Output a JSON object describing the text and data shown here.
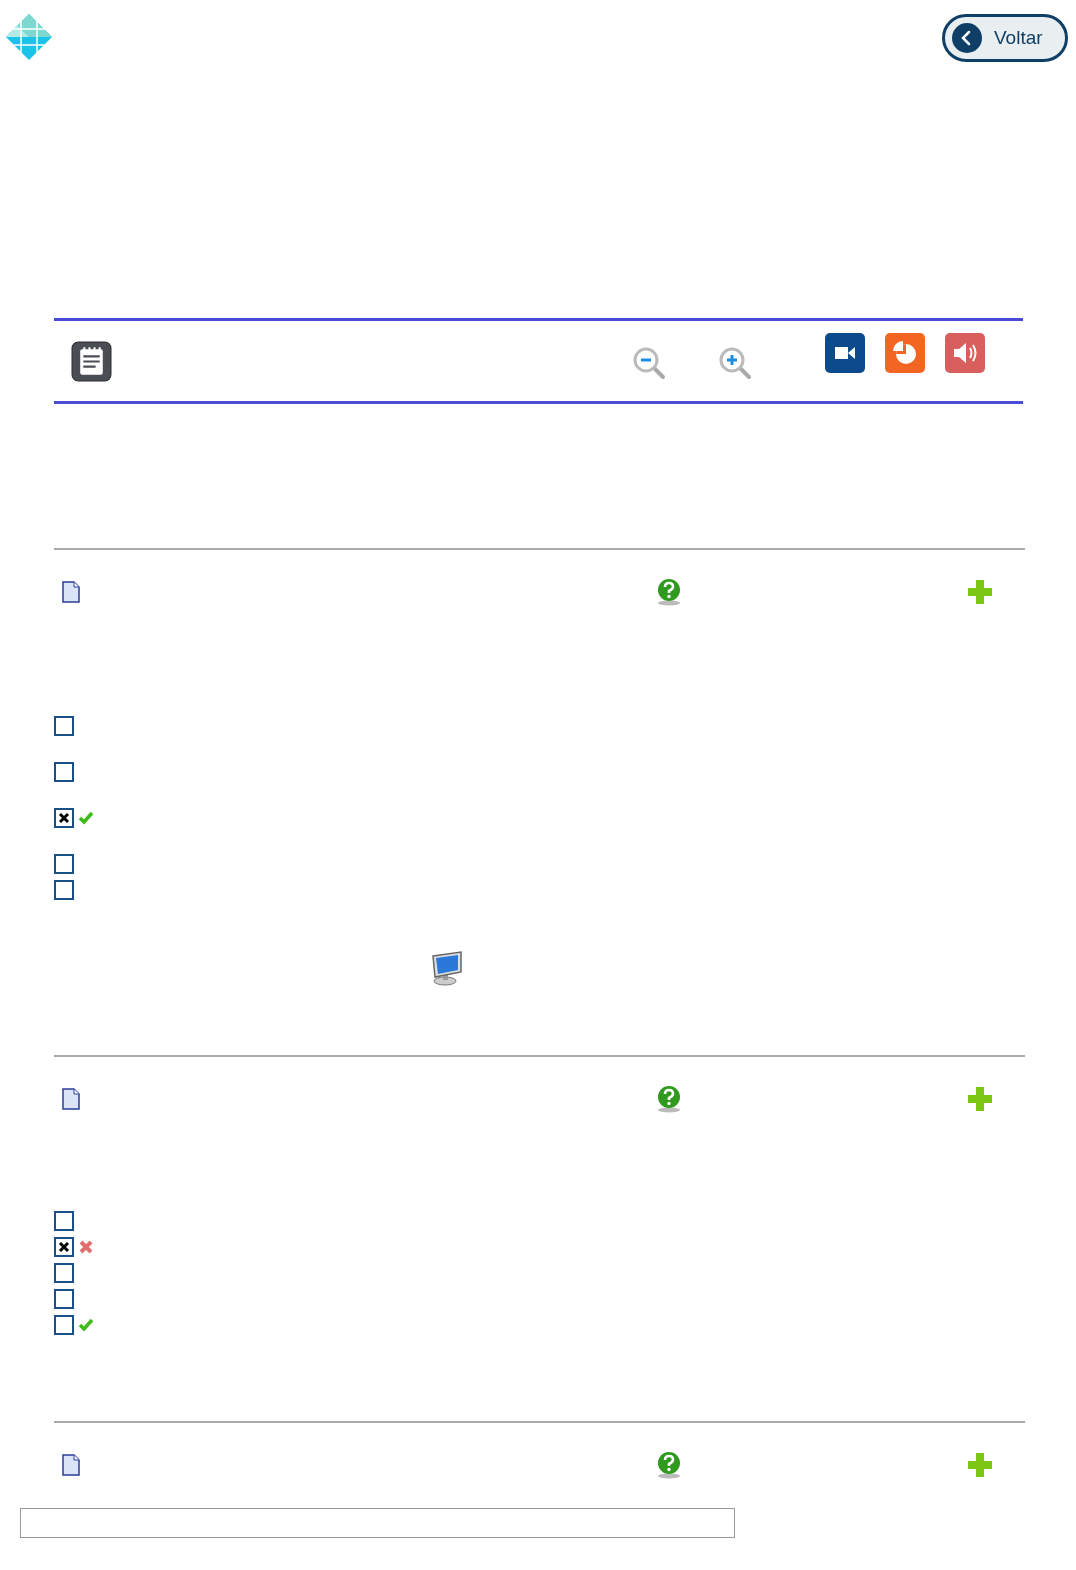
{
  "header": {
    "back_button": "Voltar"
  },
  "questions": [
    {
      "kind": "figure",
      "options": [
        {
          "checked": false,
          "kind": "plain"
        },
        {
          "checked": false,
          "kind": "plain"
        },
        {
          "checked": true,
          "kind": "correct"
        },
        {
          "checked": false,
          "kind": "plain"
        },
        {
          "checked": false,
          "kind": "plain"
        }
      ]
    },
    {
      "kind": "plain",
      "options": [
        {
          "checked": false,
          "kind": "plain"
        },
        {
          "checked": true,
          "kind": "wrong"
        },
        {
          "checked": false,
          "kind": "plain"
        },
        {
          "checked": false,
          "kind": "plain"
        },
        {
          "checked": false,
          "kind": "correct"
        }
      ]
    },
    {
      "kind": "plain"
    }
  ]
}
